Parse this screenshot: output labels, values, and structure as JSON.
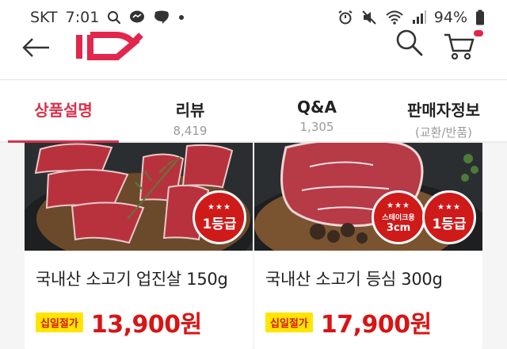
{
  "status_bar": {
    "carrier": "SKT",
    "time": "7:01",
    "battery": "94%",
    "icons": [
      "search-icon",
      "messenger-icon",
      "talk-icon",
      "dot-icon",
      "alarm-icon",
      "mute-icon",
      "wifi-icon",
      "signal-icon",
      "battery-icon"
    ]
  },
  "header": {
    "icons": [
      "back-arrow-icon",
      "logo",
      "search-icon",
      "cart-icon"
    ],
    "brand_color": "#e2264d"
  },
  "tabs": [
    {
      "label": "상품설명",
      "sub": "",
      "active": true
    },
    {
      "label": "리뷰",
      "sub": "8,419",
      "active": false
    },
    {
      "label": "Q&A",
      "sub": "1,305",
      "active": false
    },
    {
      "label": "판매자정보",
      "sub": "(교환/반품)",
      "active": false
    }
  ],
  "products": [
    {
      "title": "국내산 소고기 업진살 150g",
      "sale_tag": "십일절가",
      "price": "13,900원",
      "badges": [
        {
          "stars": "★★★",
          "text": "1등급"
        }
      ]
    },
    {
      "title": "국내산 소고기 등심 300g",
      "sale_tag": "십일절가",
      "price": "17,900원",
      "badges": [
        {
          "stars": "★★★",
          "name": "스테이크용",
          "size": "3cm"
        },
        {
          "stars": "★★★",
          "text": "1등급"
        }
      ]
    }
  ],
  "colors": {
    "accent": "#d7314c",
    "price": "#d81414",
    "sale_tag_bg": "#ffe500"
  }
}
